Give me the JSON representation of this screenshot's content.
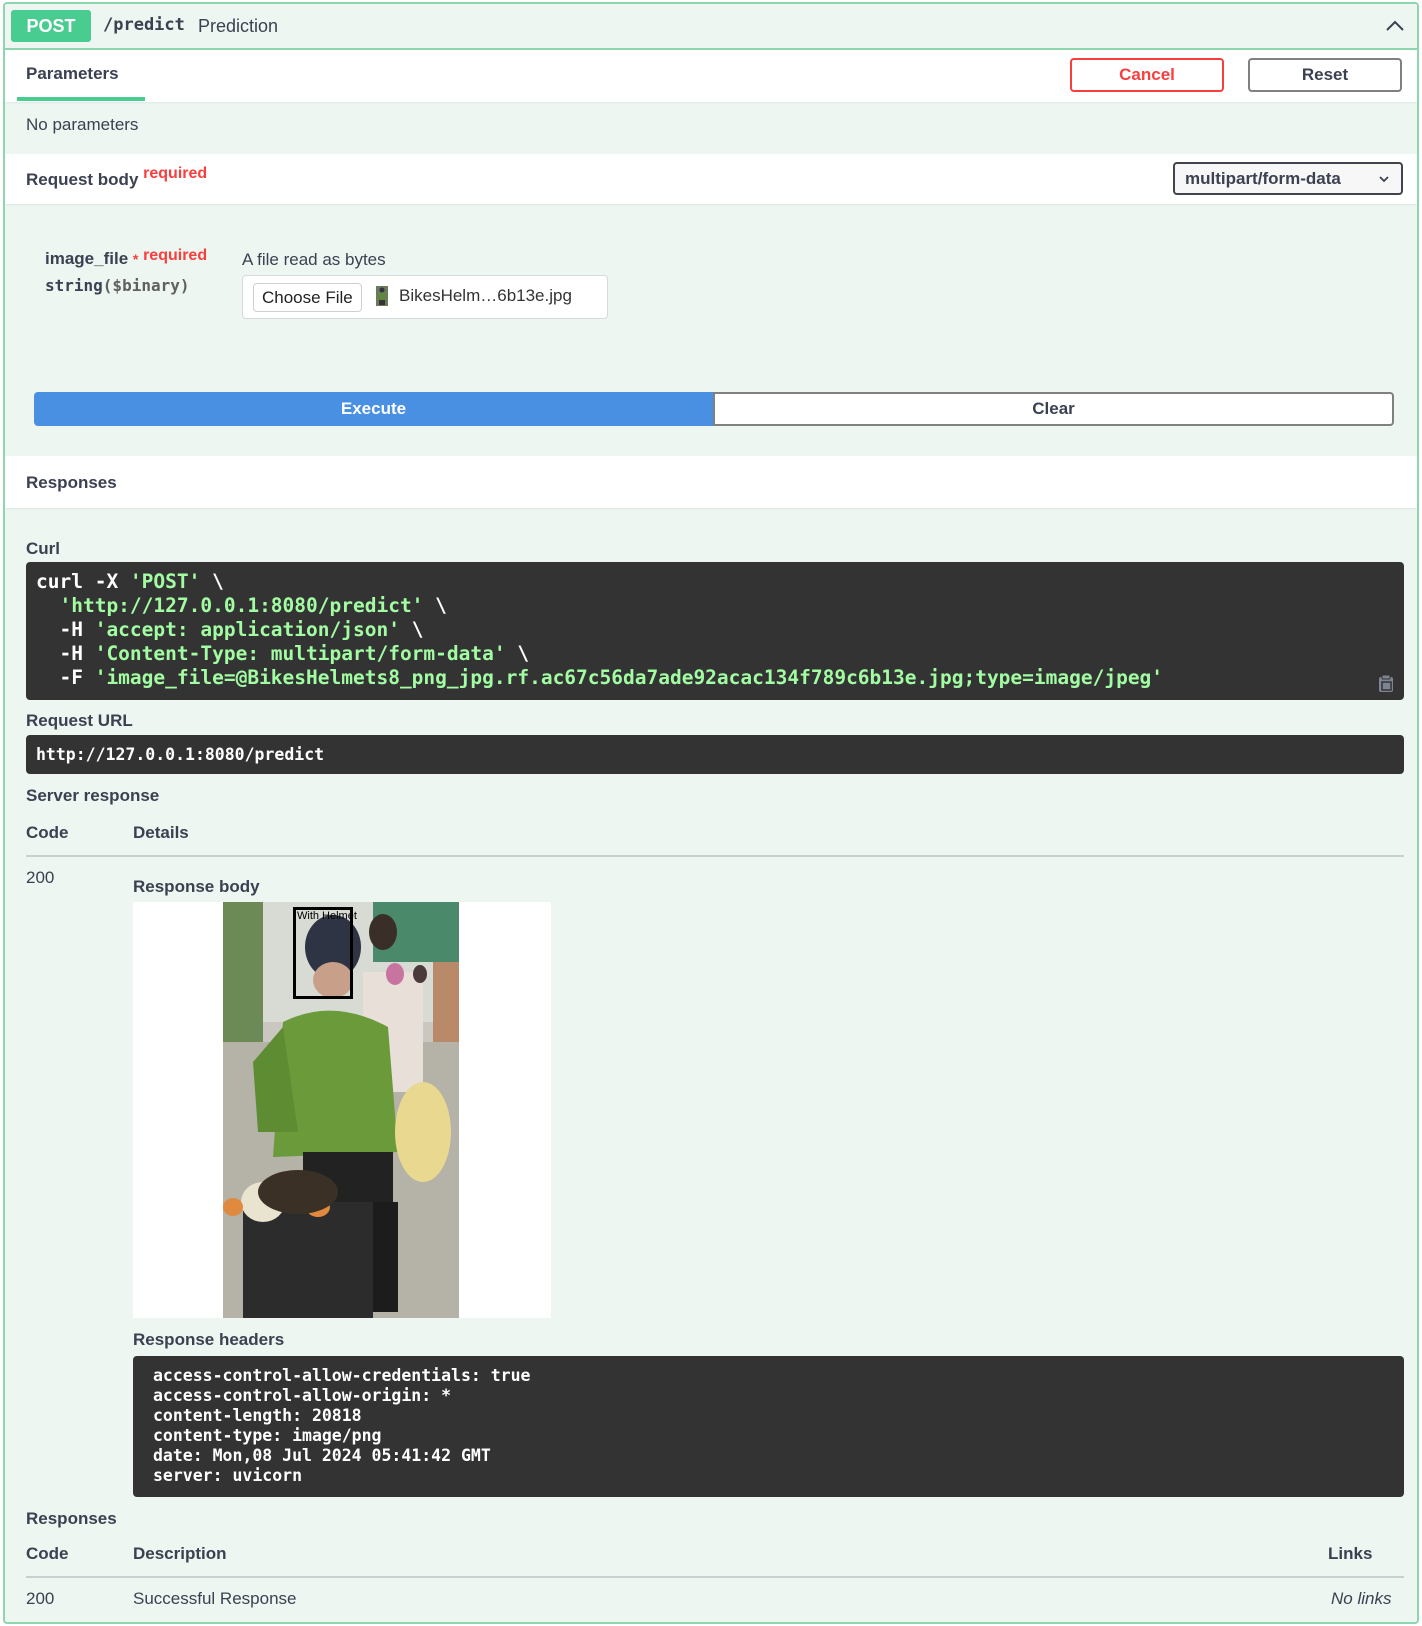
{
  "operation": {
    "method": "POST",
    "path": "/predict",
    "summary": "Prediction"
  },
  "parameters": {
    "tab_label": "Parameters",
    "cancel_label": "Cancel",
    "reset_label": "Reset",
    "empty_text": "No parameters"
  },
  "request_body": {
    "label": "Request body",
    "required_label": "required",
    "content_type": "multipart/form-data",
    "field": {
      "name": "image_file",
      "star": "*",
      "required_label": "required",
      "type": "string",
      "format": "($binary)",
      "description": "A file read as bytes",
      "choose_file_label": "Choose File",
      "file_name": "BikesHelm…6b13e.jpg"
    }
  },
  "actions": {
    "execute_label": "Execute",
    "clear_label": "Clear"
  },
  "responses_header": "Responses",
  "curl": {
    "label": "Curl",
    "lines": [
      {
        "plain": "curl -X ",
        "str": "'POST'",
        "after": " \\"
      },
      {
        "plain": "  ",
        "str": "'http://127.0.0.1:8080/predict'",
        "after": " \\"
      },
      {
        "plain": "  -H ",
        "str": "'accept: application/json'",
        "after": " \\"
      },
      {
        "plain": "  -H ",
        "str": "'Content-Type: multipart/form-data'",
        "after": " \\"
      },
      {
        "plain": "  -F ",
        "str": "'image_file=@BikesHelmets8_png_jpg.rf.ac67c56da7ade92acac134f789c6b13e.jpg;type=image/jpeg'",
        "after": ""
      }
    ]
  },
  "request_url": {
    "label": "Request URL",
    "value": "http://127.0.0.1:8080/predict"
  },
  "server_response": {
    "label": "Server response",
    "code_header": "Code",
    "details_header": "Details",
    "code": "200",
    "body_label": "Response body",
    "detection_label": "With Helmet",
    "headers_label": "Response headers",
    "headers": [
      "access-control-allow-credentials: true",
      "access-control-allow-origin: *",
      "content-length: 20818",
      "content-type: image/png",
      "date: Mon,08 Jul 2024 05:41:42 GMT",
      "server: uvicorn"
    ]
  },
  "responses": {
    "label": "Responses",
    "code_header": "Code",
    "description_header": "Description",
    "links_header": "Links",
    "rows": [
      {
        "code": "200",
        "description": "Successful Response",
        "links": "No links"
      }
    ]
  },
  "colors": {
    "post_method": "#49cc90",
    "opblock_bg": "#edf6f0",
    "execute": "#4990e2",
    "cancel": "#f93e3e",
    "required": "#f93e3e",
    "code_bg": "#333333",
    "code_string": "#a2fca2"
  },
  "icons": {
    "collapse": "chevron-up-icon",
    "select": "chevron-down-icon",
    "copy": "copy-icon",
    "file": "image-file-icon"
  }
}
